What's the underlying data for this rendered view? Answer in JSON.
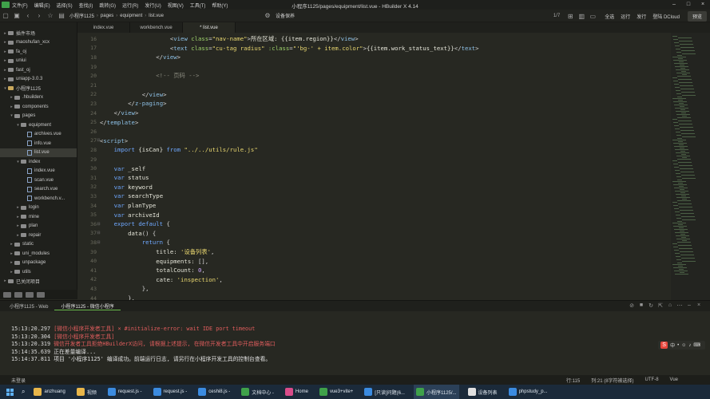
{
  "window": {
    "title": "小程序1125/pages/equipment/list.vue - HBuilder X 4.14",
    "menu": [
      "文件(F)",
      "编辑(E)",
      "选择(S)",
      "查找(I)",
      "跳转(G)",
      "运行(R)",
      "发行(U)",
      "视图(V)",
      "工具(T)",
      "帮助(Y)"
    ]
  },
  "toolbar": {
    "breadcrumb": [
      "小程序1125",
      "pages",
      "equipment",
      "list.vue"
    ],
    "right_settings_label": "设备保养",
    "page_counter": "1/7",
    "actions": [
      "全选",
      "运行",
      "发行",
      "登陆 DCloud"
    ],
    "preview_label": "预览"
  },
  "sidebar": {
    "items": [
      {
        "label": "插件市场",
        "depth": 0,
        "arrow": ">",
        "type": "folder"
      },
      {
        "label": "maoshufan_xcx",
        "depth": 0,
        "arrow": ">",
        "type": "folder"
      },
      {
        "label": "fa_oj",
        "depth": 0,
        "arrow": ">",
        "type": "folder"
      },
      {
        "label": "uniui",
        "depth": 0,
        "arrow": ">",
        "type": "folder"
      },
      {
        "label": "fast_oj",
        "depth": 0,
        "arrow": ">",
        "type": "folder"
      },
      {
        "label": "uniapp-3.0.3",
        "depth": 0,
        "arrow": ">",
        "type": "folder"
      },
      {
        "label": "小程序1125",
        "depth": 0,
        "arrow": "v",
        "type": "project"
      },
      {
        "label": ".hbuilderx",
        "depth": 1,
        "arrow": ">",
        "type": "folder"
      },
      {
        "label": "components",
        "depth": 1,
        "arrow": ">",
        "type": "folder"
      },
      {
        "label": "pages",
        "depth": 1,
        "arrow": "v",
        "type": "folder"
      },
      {
        "label": "equipment",
        "depth": 2,
        "arrow": "v",
        "type": "folder"
      },
      {
        "label": "archives.vue",
        "depth": 3,
        "arrow": "",
        "type": "file"
      },
      {
        "label": "info.vue",
        "depth": 3,
        "arrow": "",
        "type": "file"
      },
      {
        "label": "list.vue",
        "depth": 3,
        "arrow": "",
        "type": "file",
        "active": true
      },
      {
        "label": "index",
        "depth": 2,
        "arrow": "v",
        "type": "folder"
      },
      {
        "label": "index.vue",
        "depth": 3,
        "arrow": "",
        "type": "file"
      },
      {
        "label": "scan.vue",
        "depth": 3,
        "arrow": "",
        "type": "file"
      },
      {
        "label": "search.vue",
        "depth": 3,
        "arrow": "",
        "type": "file"
      },
      {
        "label": "workbench.v...",
        "depth": 3,
        "arrow": "",
        "type": "file"
      },
      {
        "label": "login",
        "depth": 2,
        "arrow": ">",
        "type": "folder"
      },
      {
        "label": "mine",
        "depth": 2,
        "arrow": ">",
        "type": "folder"
      },
      {
        "label": "plan",
        "depth": 2,
        "arrow": ">",
        "type": "folder"
      },
      {
        "label": "repair",
        "depth": 2,
        "arrow": ">",
        "type": "folder"
      },
      {
        "label": "static",
        "depth": 1,
        "arrow": ">",
        "type": "folder"
      },
      {
        "label": "uni_modules",
        "depth": 1,
        "arrow": ">",
        "type": "folder"
      },
      {
        "label": "unpackage",
        "depth": 1,
        "arrow": ">",
        "type": "folder"
      },
      {
        "label": "utils",
        "depth": 1,
        "arrow": ">",
        "type": "folder"
      },
      {
        "label": "已关闭项目",
        "depth": 0,
        "arrow": ">",
        "type": "folder"
      }
    ]
  },
  "tabs": [
    {
      "label": "index.vue",
      "active": false
    },
    {
      "label": "workbench.vue",
      "active": false
    },
    {
      "label": "* list.vue",
      "active": true
    }
  ],
  "editor": {
    "lines": [
      {
        "n": "16",
        "fold": "",
        "tokens": [
          [
            "t-pun",
            "                    <"
          ],
          [
            "t-tag",
            "view"
          ],
          [
            "t-attr",
            " class"
          ],
          [
            "t-pun",
            "="
          ],
          [
            "t-str",
            "\"nav-name\""
          ],
          [
            "t-pun",
            ">"
          ],
          [
            "t-txt",
            "所在区域: {{item.region}}"
          ],
          [
            "t-pun",
            "</"
          ],
          [
            "t-tag",
            "view"
          ],
          [
            "t-pun",
            ">"
          ]
        ]
      },
      {
        "n": "17",
        "fold": "",
        "tokens": [
          [
            "t-pun",
            "                    <"
          ],
          [
            "t-tag",
            "text"
          ],
          [
            "t-attr",
            " class"
          ],
          [
            "t-pun",
            "="
          ],
          [
            "t-str",
            "\"cu-tag radius\""
          ],
          [
            "t-attr",
            " :class"
          ],
          [
            "t-pun",
            "="
          ],
          [
            "t-str",
            "\"'bg-' + item.color\""
          ],
          [
            "t-pun",
            ">"
          ],
          [
            "t-txt",
            "{{item.work_status_text}}"
          ],
          [
            "t-pun",
            "</"
          ],
          [
            "t-tag",
            "text"
          ],
          [
            "t-pun",
            ">"
          ]
        ]
      },
      {
        "n": "18",
        "fold": "",
        "tokens": [
          [
            "t-pun",
            "                </"
          ],
          [
            "t-tag",
            "view"
          ],
          [
            "t-pun",
            ">"
          ]
        ]
      },
      {
        "n": "19",
        "fold": "",
        "tokens": [
          [
            "t-txt",
            ""
          ]
        ]
      },
      {
        "n": "20",
        "fold": "",
        "tokens": [
          [
            "t-com",
            "                <!-- 页码 -->"
          ]
        ]
      },
      {
        "n": "21",
        "fold": "",
        "tokens": [
          [
            "t-txt",
            ""
          ]
        ]
      },
      {
        "n": "22",
        "fold": "",
        "tokens": [
          [
            "t-pun",
            "            </"
          ],
          [
            "t-tag",
            "view"
          ],
          [
            "t-pun",
            ">"
          ]
        ]
      },
      {
        "n": "23",
        "fold": "",
        "tokens": [
          [
            "t-pun",
            "        </"
          ],
          [
            "t-tag",
            "z-paging"
          ],
          [
            "t-pun",
            ">"
          ]
        ]
      },
      {
        "n": "24",
        "fold": "",
        "tokens": [
          [
            "t-pun",
            "    </"
          ],
          [
            "t-tag",
            "view"
          ],
          [
            "t-pun",
            ">"
          ]
        ]
      },
      {
        "n": "25",
        "fold": "",
        "tokens": [
          [
            "t-pun",
            "</"
          ],
          [
            "t-tag",
            "template"
          ],
          [
            "t-pun",
            ">"
          ]
        ]
      },
      {
        "n": "26",
        "fold": "",
        "tokens": [
          [
            "t-txt",
            ""
          ]
        ]
      },
      {
        "n": "27",
        "fold": "⊟",
        "tokens": [
          [
            "t-pun",
            "<"
          ],
          [
            "t-tag",
            "script"
          ],
          [
            "t-pun",
            ">"
          ]
        ]
      },
      {
        "n": "28",
        "fold": "",
        "tokens": [
          [
            "t-kw",
            "    import"
          ],
          [
            "t-var",
            " {isCan} "
          ],
          [
            "t-kw",
            "from"
          ],
          [
            "t-str",
            " \"../../utils/rule.js\""
          ]
        ]
      },
      {
        "n": "29",
        "fold": "",
        "tokens": [
          [
            "t-txt",
            ""
          ]
        ]
      },
      {
        "n": "30",
        "fold": "",
        "tokens": [
          [
            "t-kw",
            "    var"
          ],
          [
            "t-var",
            " _self"
          ]
        ]
      },
      {
        "n": "31",
        "fold": "",
        "tokens": [
          [
            "t-kw",
            "    var"
          ],
          [
            "t-var",
            " status"
          ]
        ]
      },
      {
        "n": "32",
        "fold": "",
        "tokens": [
          [
            "t-kw",
            "    var"
          ],
          [
            "t-var",
            " keyword"
          ]
        ]
      },
      {
        "n": "33",
        "fold": "",
        "tokens": [
          [
            "t-kw",
            "    var"
          ],
          [
            "t-var",
            " searchType"
          ]
        ]
      },
      {
        "n": "34",
        "fold": "",
        "tokens": [
          [
            "t-kw",
            "    var"
          ],
          [
            "t-var",
            " planType"
          ]
        ]
      },
      {
        "n": "35",
        "fold": "",
        "tokens": [
          [
            "t-kw",
            "    var"
          ],
          [
            "t-var",
            " archiveId"
          ]
        ]
      },
      {
        "n": "36",
        "fold": "⊟",
        "tokens": [
          [
            "t-kw",
            "    export default"
          ],
          [
            "t-pun",
            " {"
          ]
        ]
      },
      {
        "n": "37",
        "fold": "⊟",
        "tokens": [
          [
            "t-var",
            "        data"
          ],
          [
            "t-pun",
            "() {"
          ]
        ]
      },
      {
        "n": "38",
        "fold": "⊟",
        "tokens": [
          [
            "t-kw",
            "            return"
          ],
          [
            "t-pun",
            " {"
          ]
        ]
      },
      {
        "n": "39",
        "fold": "",
        "tokens": [
          [
            "t-var",
            "                title: "
          ],
          [
            "t-str",
            "'设备列表'"
          ],
          [
            "t-pun",
            ","
          ]
        ]
      },
      {
        "n": "40",
        "fold": "",
        "tokens": [
          [
            "t-var",
            "                equipments: "
          ],
          [
            "t-pun",
            "[],"
          ]
        ]
      },
      {
        "n": "41",
        "fold": "",
        "tokens": [
          [
            "t-var",
            "                totalCount: "
          ],
          [
            "t-num",
            "0"
          ],
          [
            "t-pun",
            ","
          ]
        ]
      },
      {
        "n": "42",
        "fold": "",
        "tokens": [
          [
            "t-var",
            "                cate: "
          ],
          [
            "t-str",
            "'inspection'"
          ],
          [
            "t-pun",
            ","
          ]
        ]
      },
      {
        "n": "43",
        "fold": "",
        "tokens": [
          [
            "t-pun",
            "            },"
          ]
        ]
      },
      {
        "n": "44",
        "fold": "",
        "tokens": [
          [
            "t-pun",
            "        },"
          ]
        ]
      }
    ]
  },
  "console": {
    "tabs": [
      {
        "label": "小程序1125 - Web",
        "active": false
      },
      {
        "label": "小程序1125 - 微信小程序",
        "active": true
      }
    ],
    "lines": [
      {
        "time": "15:13:20.297",
        "text": " [微信小程序开发者工具] × #initialize-error: wait IDE port timeout",
        "kind": "c-err"
      },
      {
        "time": "15:13:20.304",
        "text": " [微信小程序开发者工具]",
        "kind": "c-err"
      },
      {
        "time": "15:13:20.319",
        "text": " 微信开发者工具拒绝HBuilderX访问, 请根据上述提示, 在微信开发者工具中开启服务端口",
        "kind": "c-err"
      },
      {
        "time": "15:14:35.639",
        "text": " 正在差量编译...",
        "kind": "c-ok"
      },
      {
        "time": "15:14:37.811",
        "text": " 项目 '小程序1125' 编译成功。前端运行日志, 请另行在小程序开发工具的控制台查看。",
        "kind": "c-ok"
      }
    ],
    "ime_label": "中"
  },
  "statusbar": {
    "left": "未登录",
    "right": [
      "行:115",
      "列:21 (8字符被选择)",
      "UTF-8",
      "Vue"
    ]
  },
  "taskbar": {
    "items": [
      {
        "label": "anzhuang",
        "color": "#e8b64a"
      },
      {
        "label": "视频",
        "color": "#e8b64a"
      },
      {
        "label": "request.js -",
        "color": "#3b8be0"
      },
      {
        "label": "request.js -",
        "color": "#3b8be0"
      },
      {
        "label": "ceshi8.js -",
        "color": "#3b8be0"
      },
      {
        "label": "文档中心 -",
        "color": "#3fa14a"
      },
      {
        "label": "Home",
        "color": "#d94c8a"
      },
      {
        "label": "vue3+vite+",
        "color": "#3fa14a"
      },
      {
        "label": "[只读]问题(6...",
        "color": "#3b8be0"
      },
      {
        "label": "小程序1125/...",
        "color": "#3fa14a",
        "active": true
      },
      {
        "label": "设备列表",
        "color": "#e0e0e0"
      },
      {
        "label": "phpstudy_p...",
        "color": "#3b8be0"
      }
    ]
  }
}
